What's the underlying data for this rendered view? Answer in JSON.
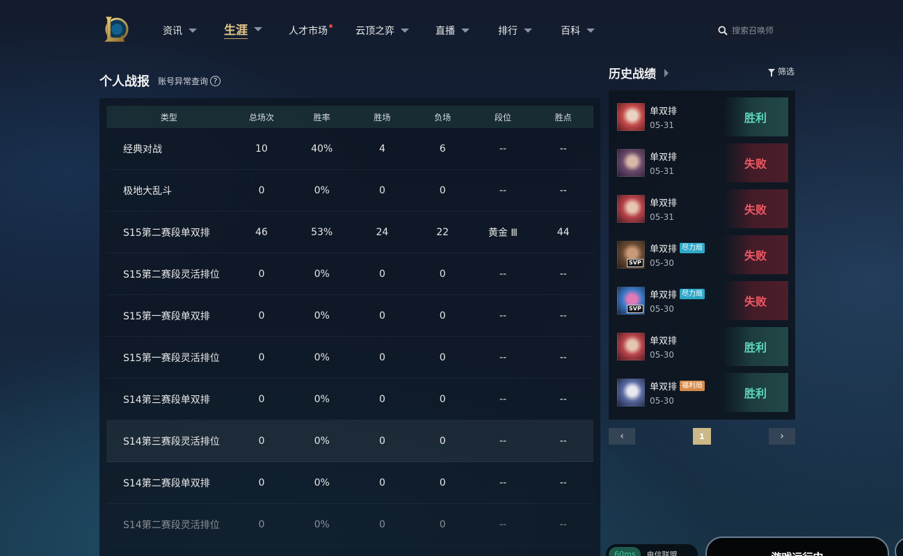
{
  "nav": {
    "items": [
      {
        "label": "资讯",
        "caret": true
      },
      {
        "label": "生涯",
        "caret": true,
        "active": true
      },
      {
        "label": "人才市场",
        "dot": true
      },
      {
        "label": "云顶之弈",
        "caret": true
      },
      {
        "label": "直播",
        "caret": true
      },
      {
        "label": "排行",
        "caret": true
      },
      {
        "label": "百科",
        "caret": true
      }
    ],
    "search_placeholder": "搜索召唤师"
  },
  "personal": {
    "title": "个人战报",
    "account_link": "账号异常查询",
    "help_symbol": "?",
    "columns": [
      "类型",
      "总场次",
      "胜率",
      "胜场",
      "负场",
      "段位",
      "胜点"
    ],
    "rows": [
      [
        "经典对战",
        "10",
        "40%",
        "4",
        "6",
        "--",
        "--"
      ],
      [
        "极地大乱斗",
        "0",
        "0%",
        "0",
        "0",
        "--",
        "--"
      ],
      [
        "S15第二赛段单双排",
        "46",
        "53%",
        "24",
        "22",
        "黄金 Ⅲ",
        "44"
      ],
      [
        "S15第二赛段灵活排位",
        "0",
        "0%",
        "0",
        "0",
        "--",
        "--"
      ],
      [
        "S15第一赛段单双排",
        "0",
        "0%",
        "0",
        "0",
        "--",
        "--"
      ],
      [
        "S15第一赛段灵活排位",
        "0",
        "0%",
        "0",
        "0",
        "--",
        "--"
      ],
      [
        "S14第三赛段单双排",
        "0",
        "0%",
        "0",
        "0",
        "--",
        "--"
      ],
      [
        "S14第三赛段灵活排位",
        "0",
        "0%",
        "0",
        "0",
        "--",
        "--"
      ],
      [
        "S14第二赛段单双排",
        "0",
        "0%",
        "0",
        "0",
        "--",
        "--"
      ],
      [
        "S14第二赛段灵活排位",
        "0",
        "0%",
        "0",
        "0",
        "--",
        "--"
      ]
    ]
  },
  "history": {
    "title": "历史战绩",
    "filter_label": "筛选",
    "matches": [
      {
        "mode": "单双排",
        "date": "05-31",
        "result": "胜利",
        "win": true,
        "tag": "",
        "svp": false,
        "colors": [
          "#5b1a22",
          "#c44a4a",
          "#e9d2c2"
        ]
      },
      {
        "mode": "单双排",
        "date": "05-31",
        "result": "失败",
        "win": false,
        "tag": "",
        "svp": false,
        "colors": [
          "#2c1f3a",
          "#6b4a6a",
          "#d7b8a8"
        ]
      },
      {
        "mode": "单双排",
        "date": "05-31",
        "result": "失败",
        "win": false,
        "tag": "",
        "svp": false,
        "colors": [
          "#4a1a22",
          "#b8434a",
          "#e6c4b0"
        ]
      },
      {
        "mode": "单双排",
        "date": "05-30",
        "result": "失败",
        "win": false,
        "tag": "尽力局",
        "tag_color": "blue",
        "svp": true,
        "svp_label": "SVP",
        "colors": [
          "#2a2018",
          "#6a4a32",
          "#c99a78"
        ]
      },
      {
        "mode": "单双排",
        "date": "05-30",
        "result": "失败",
        "win": false,
        "tag": "尽力局",
        "tag_color": "blue",
        "svp": true,
        "svp_label": "SVP",
        "colors": [
          "#1c2a4a",
          "#3a7ac8",
          "#e07ab8"
        ]
      },
      {
        "mode": "单双排",
        "date": "05-30",
        "result": "胜利",
        "win": true,
        "tag": "",
        "svp": false,
        "colors": [
          "#4a1a22",
          "#b8434a",
          "#e6c4b0"
        ]
      },
      {
        "mode": "单双排",
        "date": "05-30",
        "result": "胜利",
        "win": true,
        "tag": "福利局",
        "tag_color": "orange",
        "svp": false,
        "colors": [
          "#1a2440",
          "#5a6aa0",
          "#e8e8f0"
        ]
      }
    ],
    "pager": {
      "prev": "‹",
      "current": "1",
      "next": "›"
    }
  },
  "status": {
    "ping": "60ms",
    "ping_label": "电信联盟",
    "game_button": "游戏运行中"
  }
}
